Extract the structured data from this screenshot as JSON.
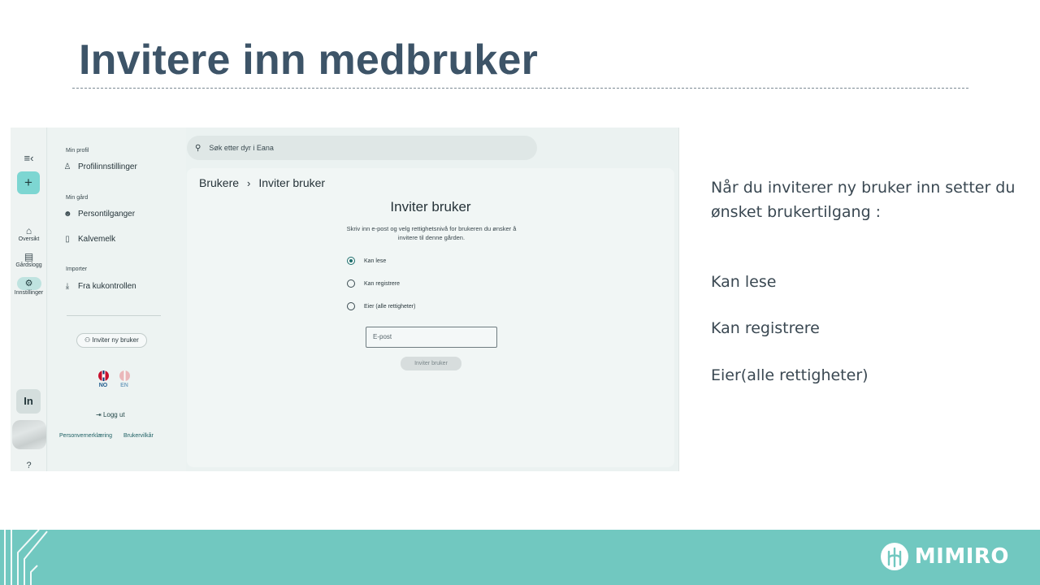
{
  "slide": {
    "title": "Invitere inn medbruker",
    "notes_intro": "Når du inviterer ny bruker inn setter du ønsket brukertilgang :",
    "notes_options": [
      "Kan lese",
      "Kan registrere",
      "Eier(alle rettigheter)"
    ],
    "brand": "MIMIRO",
    "colors": {
      "title": "#3d5468",
      "footer": "#71c8c0",
      "accent": "#7dd6d2"
    }
  },
  "app": {
    "rail": {
      "items": [
        {
          "label": "Oversikt",
          "icon": "home-icon"
        },
        {
          "label": "Gårdslogg",
          "icon": "calendar-icon"
        },
        {
          "label": "Innstillinger",
          "icon": "gear-icon"
        }
      ]
    },
    "menu": {
      "profile_heading": "Min profil",
      "profile_item": "Profilinnstillinger",
      "farm_heading": "Min gård",
      "farm_items": [
        "Persontilganger",
        "Kalvemelk"
      ],
      "import_heading": "Importer",
      "import_item": "Fra kukontrollen",
      "invite_new_label": "Inviter ny bruker",
      "languages": [
        "NO",
        "EN"
      ],
      "logout_label": "Logg ut",
      "footer_links": [
        "Personvernerklæring",
        "Brukervilkår"
      ]
    },
    "search": {
      "placeholder": "Søk etter dyr i Eana"
    },
    "breadcrumb": [
      "Brukere",
      "Inviter bruker"
    ],
    "form": {
      "title": "Inviter bruker",
      "description": "Skriv inn e-post og velg rettighetsnivå for brukeren du ønsker å invitere til denne gården.",
      "options": [
        {
          "label": "Kan lese",
          "checked": true
        },
        {
          "label": "Kan registrere",
          "checked": false
        },
        {
          "label": "Eier (alle rettigheter)",
          "checked": false
        }
      ],
      "email_placeholder": "E-post",
      "submit_label": "Inviter bruker"
    }
  }
}
